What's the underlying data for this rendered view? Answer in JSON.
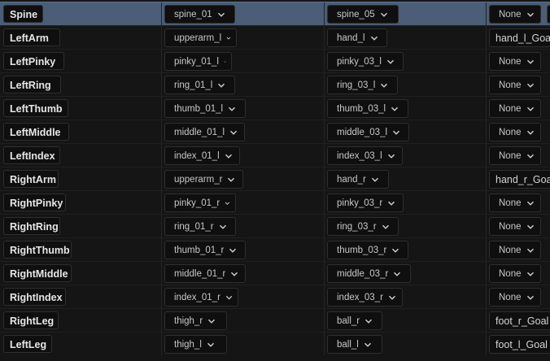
{
  "retarget_chains": [
    {
      "name": "Spine",
      "start_bone": "spine_01",
      "end_bone": "spine_05",
      "ik_goal": "None",
      "selected": true
    },
    {
      "name": "LeftArm",
      "start_bone": "upperarm_l",
      "end_bone": "hand_l",
      "ik_goal": "hand_l_Goal",
      "selected": false
    },
    {
      "name": "LeftPinky",
      "start_bone": "pinky_01_l",
      "end_bone": "pinky_03_l",
      "ik_goal": "None",
      "selected": false
    },
    {
      "name": "LeftRing",
      "start_bone": "ring_01_l",
      "end_bone": "ring_03_l",
      "ik_goal": "None",
      "selected": false
    },
    {
      "name": "LeftThumb",
      "start_bone": "thumb_01_l",
      "end_bone": "thumb_03_l",
      "ik_goal": "None",
      "selected": false
    },
    {
      "name": "LeftMiddle",
      "start_bone": "middle_01_l",
      "end_bone": "middle_03_l",
      "ik_goal": "None",
      "selected": false
    },
    {
      "name": "LeftIndex",
      "start_bone": "index_01_l",
      "end_bone": "index_03_l",
      "ik_goal": "None",
      "selected": false
    },
    {
      "name": "RightArm",
      "start_bone": "upperarm_r",
      "end_bone": "hand_r",
      "ik_goal": "hand_r_Goal",
      "selected": false
    },
    {
      "name": "RightPinky",
      "start_bone": "pinky_01_r",
      "end_bone": "pinky_03_r",
      "ik_goal": "None",
      "selected": false
    },
    {
      "name": "RightRing",
      "start_bone": "ring_01_r",
      "end_bone": "ring_03_r",
      "ik_goal": "None",
      "selected": false
    },
    {
      "name": "RightThumb",
      "start_bone": "thumb_01_r",
      "end_bone": "thumb_03_r",
      "ik_goal": "None",
      "selected": false
    },
    {
      "name": "RightMiddle",
      "start_bone": "middle_01_r",
      "end_bone": "middle_03_r",
      "ik_goal": "None",
      "selected": false
    },
    {
      "name": "RightIndex",
      "start_bone": "index_01_r",
      "end_bone": "index_03_r",
      "ik_goal": "None",
      "selected": false
    },
    {
      "name": "RightLeg",
      "start_bone": "thigh_r",
      "end_bone": "ball_r",
      "ik_goal": "foot_r_Goal",
      "selected": false
    },
    {
      "name": "LeftLeg",
      "start_bone": "thigh_l",
      "end_bone": "ball_l",
      "ik_goal": "foot_l_Goal",
      "selected": false
    }
  ],
  "colors": {
    "selected_row": "#4b5d77",
    "background": "#151515",
    "widget": "#0f0f0f"
  },
  "icons": {
    "dropdown": "chevron-down-icon"
  }
}
